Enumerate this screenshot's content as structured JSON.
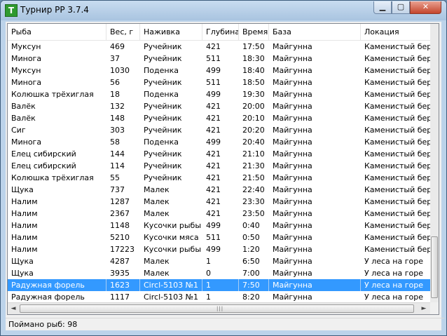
{
  "window": {
    "title": "Турнир РР 3.7.4",
    "icon_letter": "T"
  },
  "controls": {
    "minimize": "▁",
    "maximize": "▢",
    "close": "✕"
  },
  "columns": [
    "Рыба",
    "Вес, г",
    "Наживка",
    "Глубина",
    "Время",
    "База",
    "Локация"
  ],
  "rows": [
    [
      "Муксун",
      "469",
      "Ручейник",
      "421",
      "17:50",
      "Майгунна",
      "Каменистый берег"
    ],
    [
      "Минога",
      "37",
      "Ручейник",
      "511",
      "18:30",
      "Майгунна",
      "Каменистый берег"
    ],
    [
      "Муксун",
      "1030",
      "Поденка",
      "499",
      "18:40",
      "Майгунна",
      "Каменистый берег"
    ],
    [
      "Минога",
      "56",
      "Ручейник",
      "511",
      "18:50",
      "Майгунна",
      "Каменистый берег"
    ],
    [
      "Колюшка трёхиглая",
      "18",
      "Поденка",
      "499",
      "19:30",
      "Майгунна",
      "Каменистый берег"
    ],
    [
      "Валёк",
      "132",
      "Ручейник",
      "421",
      "20:00",
      "Майгунна",
      "Каменистый берег"
    ],
    [
      "Валёк",
      "148",
      "Ручейник",
      "421",
      "20:10",
      "Майгунна",
      "Каменистый берег"
    ],
    [
      "Сиг",
      "303",
      "Ручейник",
      "421",
      "20:20",
      "Майгунна",
      "Каменистый берег"
    ],
    [
      "Минога",
      "58",
      "Поденка",
      "499",
      "20:40",
      "Майгунна",
      "Каменистый берег"
    ],
    [
      "Елец сибирский",
      "144",
      "Ручейник",
      "421",
      "21:10",
      "Майгунна",
      "Каменистый берег"
    ],
    [
      "Елец сибирский",
      "114",
      "Ручейник",
      "421",
      "21:30",
      "Майгунна",
      "Каменистый берег"
    ],
    [
      "Колюшка трёхиглая",
      "55",
      "Ручейник",
      "421",
      "21:50",
      "Майгунна",
      "Каменистый берег"
    ],
    [
      "Щука",
      "737",
      "Малек",
      "421",
      "22:40",
      "Майгунна",
      "Каменистый берег"
    ],
    [
      "Налим",
      "1287",
      "Малек",
      "421",
      "23:30",
      "Майгунна",
      "Каменистый берег"
    ],
    [
      "Налим",
      "2367",
      "Малек",
      "421",
      "23:50",
      "Майгунна",
      "Каменистый берег"
    ],
    [
      "Налим",
      "1148",
      "Кусочки рыбы",
      "499",
      "0:40",
      "Майгунна",
      "Каменистый берег"
    ],
    [
      "Налим",
      "5210",
      "Кусочки мяса",
      "511",
      "0:50",
      "Майгунна",
      "Каменистый берег"
    ],
    [
      "Налим",
      "17223",
      "Кусочки рыбы",
      "499",
      "1:20",
      "Майгунна",
      "Каменистый берег"
    ],
    [
      "Щука",
      "4287",
      "Малек",
      "1",
      "6:50",
      "Майгунна",
      "У леса на горе"
    ],
    [
      "Щука",
      "3935",
      "Малек",
      "0",
      "7:00",
      "Майгунна",
      "У леса на горе"
    ],
    [
      "Радужная форель",
      "1623",
      "Circl-5103 №1",
      "1",
      "7:50",
      "Майгунна",
      "У леса на горе"
    ],
    [
      "Радужная форель",
      "1117",
      "Circl-5103 №1",
      "1",
      "8:20",
      "Майгунна",
      "У леса на горе"
    ]
  ],
  "selected_row": 20,
  "scrollbar": {
    "left_arrow": "◄",
    "right_arrow": "►",
    "grip": "|||"
  },
  "status": {
    "text": "Поймано рыб: 98"
  }
}
